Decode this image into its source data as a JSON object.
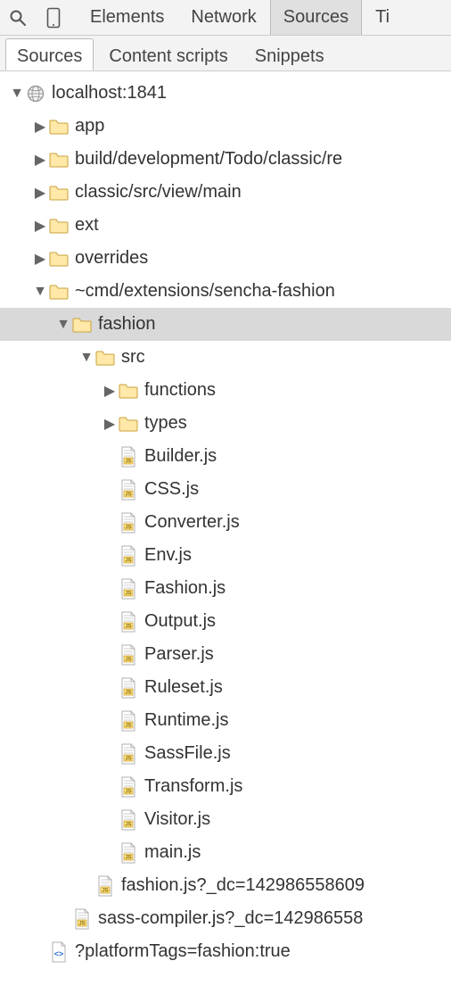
{
  "topTabs": [
    {
      "label": "Elements",
      "active": false
    },
    {
      "label": "Network",
      "active": false
    },
    {
      "label": "Sources",
      "active": true
    },
    {
      "label": "Ti",
      "active": false
    }
  ],
  "subTabs": [
    {
      "label": "Sources",
      "active": true
    },
    {
      "label": "Content scripts",
      "active": false
    },
    {
      "label": "Snippets",
      "active": false
    }
  ],
  "tree": [
    {
      "depth": 0,
      "expanded": true,
      "icon": "globe",
      "label": "localhost:1841",
      "selected": false
    },
    {
      "depth": 1,
      "expanded": false,
      "icon": "folder",
      "label": "app",
      "selected": false
    },
    {
      "depth": 1,
      "expanded": false,
      "icon": "folder",
      "label": "build/development/Todo/classic/re",
      "selected": false
    },
    {
      "depth": 1,
      "expanded": false,
      "icon": "folder",
      "label": "classic/src/view/main",
      "selected": false
    },
    {
      "depth": 1,
      "expanded": false,
      "icon": "folder",
      "label": "ext",
      "selected": false
    },
    {
      "depth": 1,
      "expanded": false,
      "icon": "folder",
      "label": "overrides",
      "selected": false
    },
    {
      "depth": 1,
      "expanded": true,
      "icon": "folder",
      "label": "~cmd/extensions/sencha-fashion",
      "selected": false
    },
    {
      "depth": 2,
      "expanded": true,
      "icon": "folder",
      "label": "fashion",
      "selected": true
    },
    {
      "depth": 3,
      "expanded": true,
      "icon": "folder",
      "label": "src",
      "selected": false
    },
    {
      "depth": 4,
      "expanded": false,
      "icon": "folder",
      "label": "functions",
      "selected": false
    },
    {
      "depth": 4,
      "expanded": false,
      "icon": "folder",
      "label": "types",
      "selected": false
    },
    {
      "depth": 4,
      "expanded": null,
      "icon": "jsfile",
      "label": "Builder.js",
      "selected": false
    },
    {
      "depth": 4,
      "expanded": null,
      "icon": "jsfile",
      "label": "CSS.js",
      "selected": false
    },
    {
      "depth": 4,
      "expanded": null,
      "icon": "jsfile",
      "label": "Converter.js",
      "selected": false
    },
    {
      "depth": 4,
      "expanded": null,
      "icon": "jsfile",
      "label": "Env.js",
      "selected": false
    },
    {
      "depth": 4,
      "expanded": null,
      "icon": "jsfile",
      "label": "Fashion.js",
      "selected": false
    },
    {
      "depth": 4,
      "expanded": null,
      "icon": "jsfile",
      "label": "Output.js",
      "selected": false
    },
    {
      "depth": 4,
      "expanded": null,
      "icon": "jsfile",
      "label": "Parser.js",
      "selected": false
    },
    {
      "depth": 4,
      "expanded": null,
      "icon": "jsfile",
      "label": "Ruleset.js",
      "selected": false
    },
    {
      "depth": 4,
      "expanded": null,
      "icon": "jsfile",
      "label": "Runtime.js",
      "selected": false
    },
    {
      "depth": 4,
      "expanded": null,
      "icon": "jsfile",
      "label": "SassFile.js",
      "selected": false
    },
    {
      "depth": 4,
      "expanded": null,
      "icon": "jsfile",
      "label": "Transform.js",
      "selected": false
    },
    {
      "depth": 4,
      "expanded": null,
      "icon": "jsfile",
      "label": "Visitor.js",
      "selected": false
    },
    {
      "depth": 4,
      "expanded": null,
      "icon": "jsfile",
      "label": "main.js",
      "selected": false
    },
    {
      "depth": 3,
      "expanded": null,
      "icon": "jsfile",
      "label": "fashion.js?_dc=142986558609",
      "selected": false
    },
    {
      "depth": 2,
      "expanded": null,
      "icon": "jsfile",
      "label": "sass-compiler.js?_dc=142986558",
      "selected": false
    },
    {
      "depth": 1,
      "expanded": null,
      "icon": "codefile",
      "label": "?platformTags=fashion:true",
      "selected": false
    }
  ],
  "indentPx": 26,
  "baseIndentPx": 10
}
